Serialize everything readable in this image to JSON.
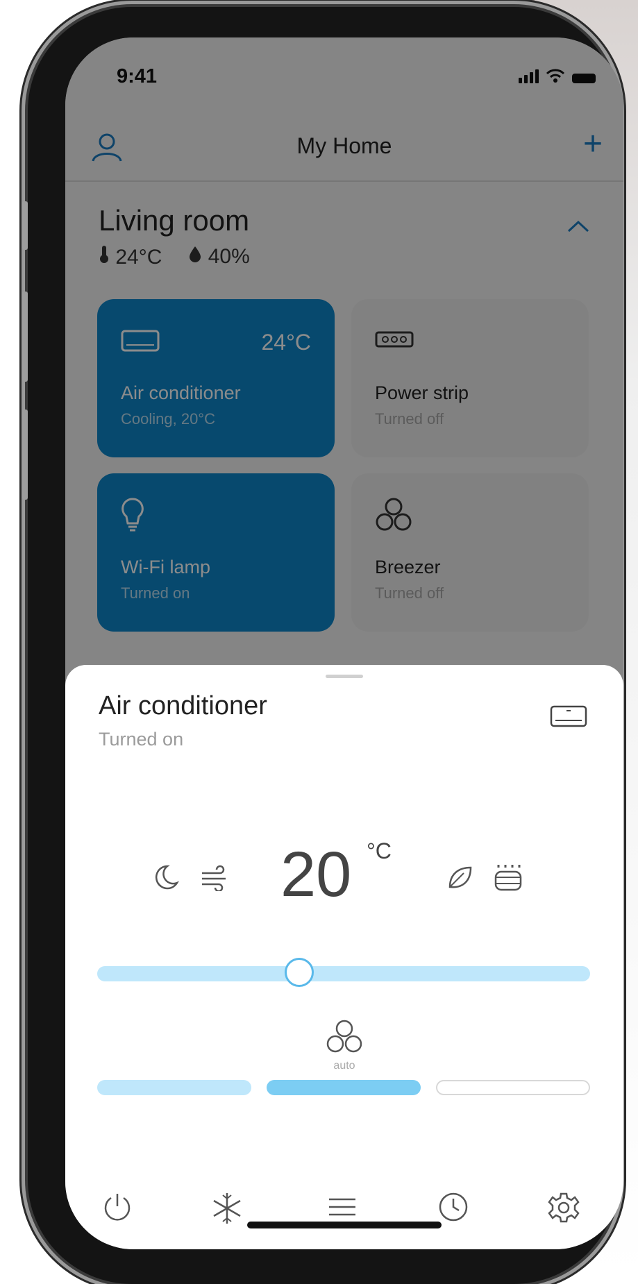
{
  "status_bar": {
    "time": "9:41"
  },
  "header": {
    "title": "My Home",
    "add_label": "+"
  },
  "room": {
    "name": "Living room",
    "temperature": "24°C",
    "humidity": "40%"
  },
  "devices": [
    {
      "name": "Air conditioner",
      "status": "Cooling, 20°C",
      "reading": "24°C",
      "state": "on",
      "icon": "air-conditioner-icon"
    },
    {
      "name": "Power strip",
      "status": "Turned off",
      "state": "off",
      "icon": "power-strip-icon"
    },
    {
      "name": "Wi-Fi  lamp",
      "status": "Turned on",
      "state": "on",
      "icon": "lightbulb-icon"
    },
    {
      "name": "Breezer",
      "status": "Turned off",
      "state": "off",
      "icon": "fan-icon"
    }
  ],
  "sheet": {
    "title": "Air conditioner",
    "status": "Turned on",
    "target_temp": "20",
    "unit": "°C",
    "temp_slider_fraction": 0.41,
    "fan_mode": "auto",
    "fan_speed_active_index": 1,
    "mode_icons": [
      "moon-icon",
      "wind-icon",
      "leaf-icon",
      "heater-icon"
    ]
  },
  "bottom_nav": [
    "power-icon",
    "snowflake-icon",
    "menu-icon",
    "clock-icon",
    "settings-icon"
  ],
  "colors": {
    "accent": "#0d86c9",
    "slider_track": "#bfe7fb",
    "slider_border": "#5ab9ea",
    "speed_active": "#7ccdf3"
  }
}
